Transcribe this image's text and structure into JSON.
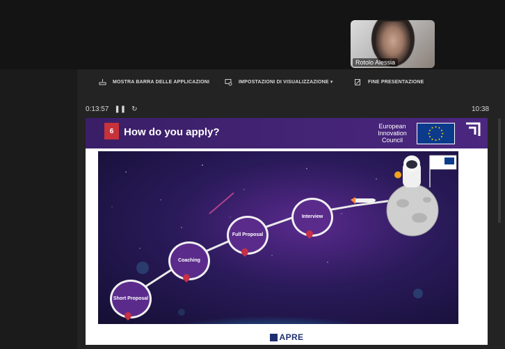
{
  "participant": {
    "name": "Rotolo Alessia"
  },
  "toolbar": {
    "show_apps": "MOSTRA BARRA DELLE APPLICAZIONI",
    "display_settings": "IMPOSTAZIONI DI VISUALIZZAZIONE ▾",
    "end_presentation": "FINE PRESENTAZIONE"
  },
  "presenter": {
    "elapsed": "0:13:57",
    "clock": "10:38",
    "pause_icon": "pause-icon",
    "restart_icon": "restart-icon"
  },
  "slide": {
    "number": "6",
    "title": "How do you apply?",
    "eic_label": "European Innovation Council",
    "steps": [
      {
        "label": "Short Proposal"
      },
      {
        "label": "Coaching"
      },
      {
        "label": "Full Proposal"
      },
      {
        "label": "Interview"
      }
    ],
    "footer_logo": "APRE",
    "colors": {
      "header": "#3a1f67",
      "step": "#5b2b8c",
      "badge": "#c8323a"
    }
  }
}
